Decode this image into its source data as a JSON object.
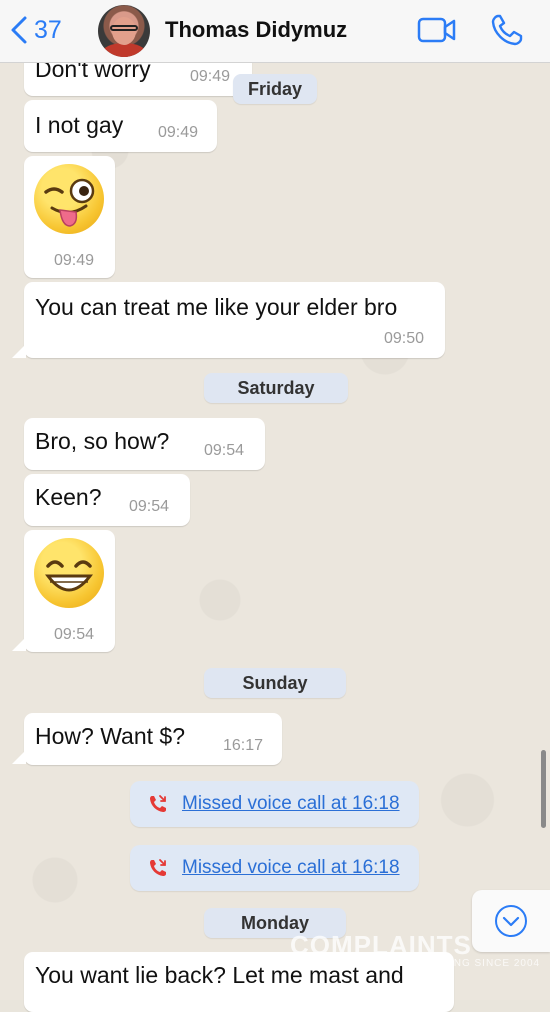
{
  "header": {
    "back_count": "37",
    "contact_name": "Thomas Didymuz",
    "accent_color": "#2b7cf6"
  },
  "messages": [
    {
      "text": "Don't worry",
      "time": "09:49"
    },
    {
      "text": "I not gay",
      "time": "09:49"
    },
    {
      "emoji": "wink-tongue-emoji",
      "time": "09:49"
    },
    {
      "text": "You can treat me like your elder bro",
      "time": "09:50"
    },
    {
      "text": "Bro, so how?",
      "time": "09:54"
    },
    {
      "text": "Keen?",
      "time": "09:54"
    },
    {
      "emoji": "grin-emoji",
      "time": "09:54"
    },
    {
      "text": "How? Want $?",
      "time": "16:17"
    },
    {
      "text": "You want lie back? Let me mast and"
    }
  ],
  "dates": [
    "Friday",
    "Saturday",
    "Sunday",
    "Monday"
  ],
  "calls": [
    {
      "label": "Missed voice call at 16:18",
      "icon": "missed-call-icon"
    },
    {
      "label": "Missed voice call at 16:18",
      "icon": "missed-call-icon"
    }
  ],
  "watermark": {
    "main": "COMPLAINTS",
    "sub": "SOLVING SINCE 2004"
  },
  "colors": {
    "missed_call": "#e53935",
    "link": "#2b6fd6",
    "date_pill": "#dfe6f2",
    "bubble": "#ffffff"
  }
}
